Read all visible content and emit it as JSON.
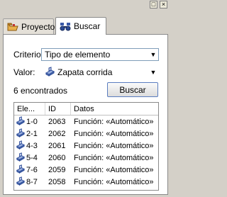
{
  "window": {
    "pin_glyph": "□",
    "close_glyph": "×"
  },
  "tabs": [
    {
      "label": "Proyecto",
      "icon": "folder-icon",
      "active": false
    },
    {
      "label": "Buscar",
      "icon": "binoculars-icon",
      "active": true
    }
  ],
  "criterio": {
    "label": "Criterio:",
    "value": "Tipo de elemento"
  },
  "valor": {
    "label": "Valor:",
    "value": "Zapata corrida",
    "icon": "footing-icon"
  },
  "results": {
    "count_text": "6 encontrados",
    "search_label": "Buscar"
  },
  "table": {
    "columns": [
      "Ele...",
      "ID",
      "Datos"
    ],
    "rows": [
      {
        "elem": "1-0",
        "id": "2063",
        "datos": "Función: «Automático»"
      },
      {
        "elem": "2-1",
        "id": "2062",
        "datos": "Función: «Automático»"
      },
      {
        "elem": "4-3",
        "id": "2061",
        "datos": "Función: «Automático»"
      },
      {
        "elem": "5-4",
        "id": "2060",
        "datos": "Función: «Automático»"
      },
      {
        "elem": "7-6",
        "id": "2059",
        "datos": "Función: «Automático»"
      },
      {
        "elem": "8-7",
        "id": "2058",
        "datos": "Función: «Automático»"
      }
    ]
  },
  "colors": {
    "panel_bg": "#d4d0c8",
    "border_blue": "#7f9db9",
    "accent": "#5a7dbf"
  }
}
